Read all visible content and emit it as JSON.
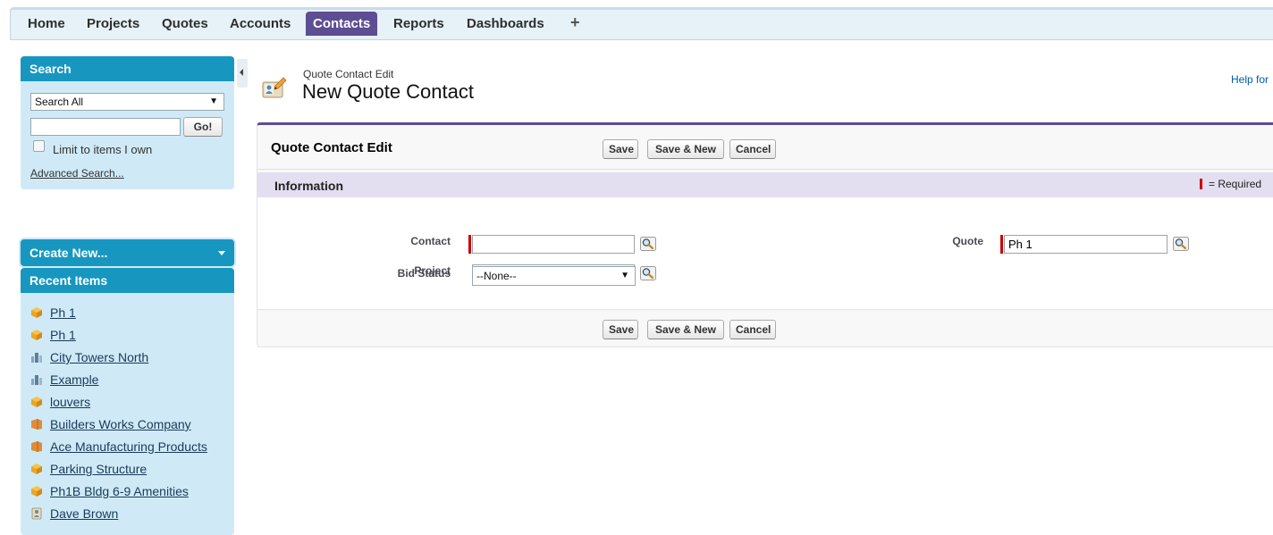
{
  "tabs": [
    {
      "label": "Home"
    },
    {
      "label": "Projects"
    },
    {
      "label": "Quotes"
    },
    {
      "label": "Accounts"
    },
    {
      "label": "Contacts",
      "active": true
    },
    {
      "label": "Reports"
    },
    {
      "label": "Dashboards"
    },
    {
      "label": "+"
    }
  ],
  "sidebar": {
    "search": {
      "title": "Search",
      "scope_selected": "Search All",
      "query_value": "",
      "go_label": "Go!",
      "limit_label": "Limit to items I own",
      "limit_checked": false,
      "advanced_label": "Advanced Search..."
    },
    "create_new": {
      "label": "Create New..."
    },
    "recent": {
      "title": "Recent Items",
      "items": [
        {
          "label": "Ph 1",
          "icon": "quote-icon"
        },
        {
          "label": "Ph 1",
          "icon": "quote-icon"
        },
        {
          "label": "City Towers North",
          "icon": "project-icon"
        },
        {
          "label": "Example",
          "icon": "project-icon"
        },
        {
          "label": "louvers",
          "icon": "quote-icon"
        },
        {
          "label": "Builders Works Company",
          "icon": "account-icon"
        },
        {
          "label": "Ace Manufacturing Products",
          "icon": "account-icon"
        },
        {
          "label": "Parking Structure",
          "icon": "quote-icon"
        },
        {
          "label": "Ph1B Bldg 6-9 Amenities",
          "icon": "quote-icon"
        },
        {
          "label": "Dave Brown",
          "icon": "contact-icon"
        }
      ]
    }
  },
  "header": {
    "breadcrumb": "Quote Contact Edit",
    "title": "New Quote Contact",
    "help_link": "Help for"
  },
  "panel": {
    "title": "Quote Contact Edit",
    "buttons": {
      "save": "Save",
      "save_new": "Save & New",
      "cancel": "Cancel"
    },
    "section_title": "Information",
    "required_legend": "= Required",
    "fields": {
      "contact": {
        "label": "Contact",
        "value": ""
      },
      "project": {
        "label": "Project",
        "value": ""
      },
      "bid_status": {
        "label": "Bid Status",
        "value": "--None--"
      },
      "quote": {
        "label": "Quote",
        "value": "Ph 1"
      }
    }
  },
  "colors": {
    "tab_active": "#5d4d92",
    "sidebar_header": "#1797c0",
    "sidebar_bg": "#cfeaf6",
    "section_bar": "#e3def0",
    "required": "#cc0000"
  }
}
